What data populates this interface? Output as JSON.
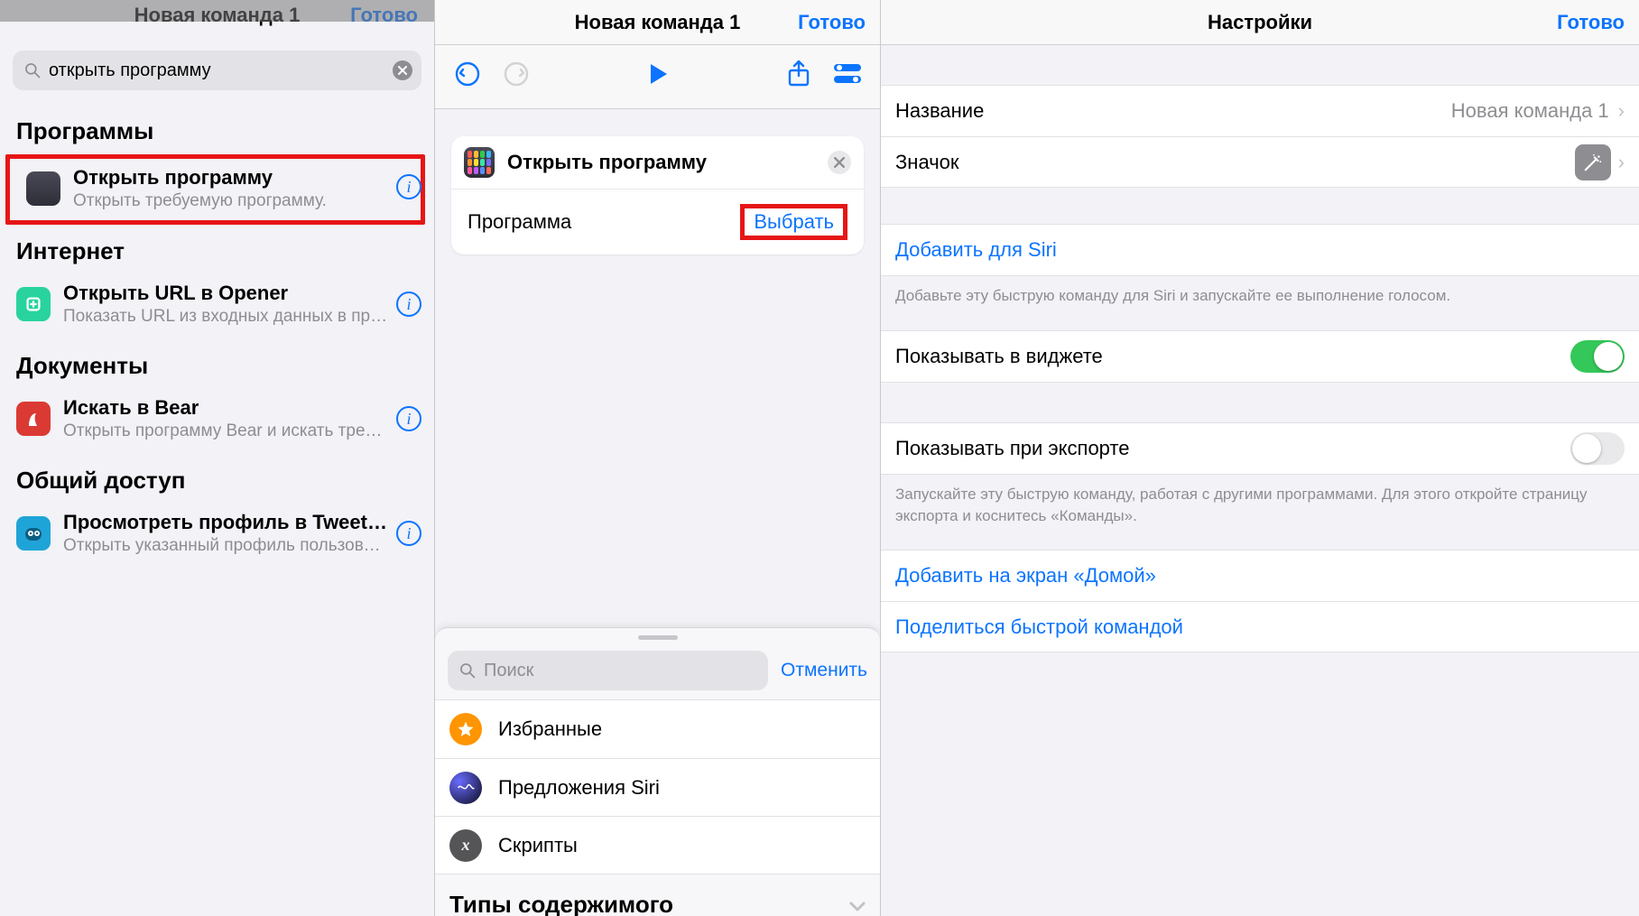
{
  "left": {
    "hidden_nav_title": "Новая команда 1",
    "hidden_nav_done": "Готово",
    "search_value": "открыть программу",
    "sections": {
      "programs": {
        "header": "Программы",
        "item": {
          "title": "Открыть программу",
          "subtitle": "Открыть требуемую программу."
        }
      },
      "internet": {
        "header": "Интернет",
        "item": {
          "title": "Открыть URL в Opener",
          "subtitle": "Показать URL из входных данных в прог…"
        }
      },
      "documents": {
        "header": "Документы",
        "item": {
          "title": "Искать в Bear",
          "subtitle": "Открыть программу Bear и искать требу…"
        }
      },
      "sharing": {
        "header": "Общий доступ",
        "item": {
          "title": "Просмотреть профиль в Tweet…",
          "subtitle": "Открыть указанный профиль пользовате…"
        }
      }
    }
  },
  "mid": {
    "nav_title": "Новая команда 1",
    "nav_done": "Готово",
    "action_title": "Открыть программу",
    "action_param_label": "Программа",
    "action_param_link": "Выбрать",
    "sheet": {
      "search_placeholder": "Поиск",
      "cancel": "Отменить",
      "items": {
        "fav": "Избранные",
        "siri": "Предложения Siri",
        "scripts": "Скрипты"
      },
      "content_section": "Типы содержимого"
    }
  },
  "right": {
    "nav_title": "Настройки",
    "nav_done": "Готово",
    "name_label": "Название",
    "name_value": "Новая команда 1",
    "icon_label": "Значок",
    "add_siri": "Добавить для Siri",
    "siri_footer": "Добавьте эту быструю команду для Siri и запускайте ее выполнение голосом.",
    "show_widget": "Показывать в виджете",
    "show_export": "Показывать при экспорте",
    "export_footer": "Запускайте эту быструю команду, работая с другими программами. Для этого откройте страницу экспорта и коснитесь «Команды».",
    "add_home": "Добавить на экран «Домой»",
    "share": "Поделиться быстрой командой"
  },
  "colors": {
    "accent": "#0c74ff",
    "highlight": "#e61616"
  }
}
